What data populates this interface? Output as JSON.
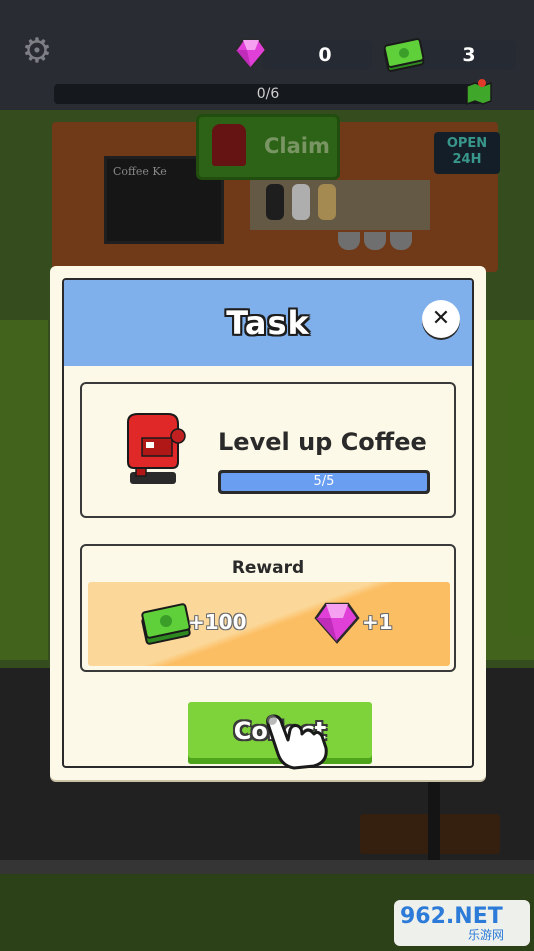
{
  "hud": {
    "settings_icon": "gear-icon",
    "gems": "0",
    "cash": "3",
    "task_progress": "0/6"
  },
  "scene": {
    "claim_label": "Claim",
    "open_sign": "OPEN 24H",
    "menu_board_title": "Coffee Ke"
  },
  "task_modal": {
    "title": "Task",
    "close_icon": "close-icon",
    "task": {
      "name": "Level up Coffee",
      "progress_text": "5/5",
      "progress_fraction": 1.0
    },
    "reward": {
      "title": "Reward",
      "items": [
        {
          "icon": "cash-icon",
          "amount": "+100"
        },
        {
          "icon": "gem-icon",
          "amount": "+1"
        }
      ]
    },
    "collect_label": "Collect"
  },
  "watermark": {
    "logo": "962.NET",
    "subtitle": "乐游网"
  },
  "colors": {
    "header_blue": "#7fb0ec",
    "collect_green": "#7ed33a",
    "progress_blue": "#6a9ef0",
    "gem_pink": "#e040d8",
    "cash_green": "#3fa82a",
    "modal_bg": "#fdf9e8"
  }
}
